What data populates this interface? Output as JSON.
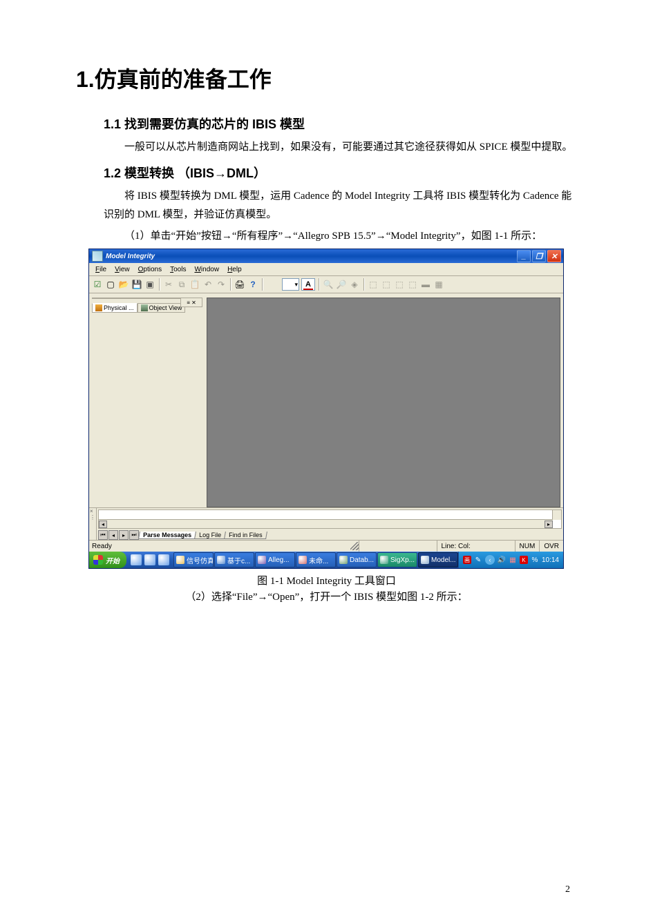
{
  "doc": {
    "main_title": "1.仿真前的准备工作",
    "section_1_1_title": "1.1 找到需要仿真的芯片的 IBIS 模型",
    "section_1_1_text": "一般可以从芯片制造商网站上找到，如果没有，可能要通过其它途径获得如从 SPICE 模型中提取。",
    "section_1_2_title": "1.2 模型转换 （IBIS→DML）",
    "section_1_2_p1": "将 IBIS 模型转换为 DML 模型，运用 Cadence 的 Model Integrity 工具将 IBIS 模型转化为 Cadence 能识别的 DML 模型，并验证仿真模型。",
    "section_1_2_p2": "（1）单击“开始”按钮→“所有程序”→“Allegro SPB 15.5”→“Model Integrity”，如图 1-1 所示：",
    "figure_caption": "图 1-1 Model Integrity 工具窗口",
    "step2_text": "（2）选择“File”→“Open”，打开一个 IBIS 模型如图 1-2 所示：",
    "page_number": "2"
  },
  "app": {
    "title": "Model Integrity",
    "menus": {
      "file": "File",
      "view": "View",
      "options": "Options",
      "tools": "Tools",
      "window": "Window",
      "help": "Help"
    },
    "side_tabs": {
      "physical": "Physical ...",
      "object": "Object View"
    },
    "log_tabs": {
      "parse": "Parse Messages",
      "logfile": "Log File",
      "findfiles": "Find in Files"
    },
    "status": {
      "ready": "Ready",
      "linecol": "Line:  Col:",
      "num": "NUM",
      "ovr": "OVR"
    }
  },
  "taskbar": {
    "start": "开始",
    "items": [
      "信号仿真",
      "基于c...",
      "Alleg...",
      "未命...",
      "Datab...",
      "SigXp...",
      "Model..."
    ],
    "time": "10:14"
  }
}
